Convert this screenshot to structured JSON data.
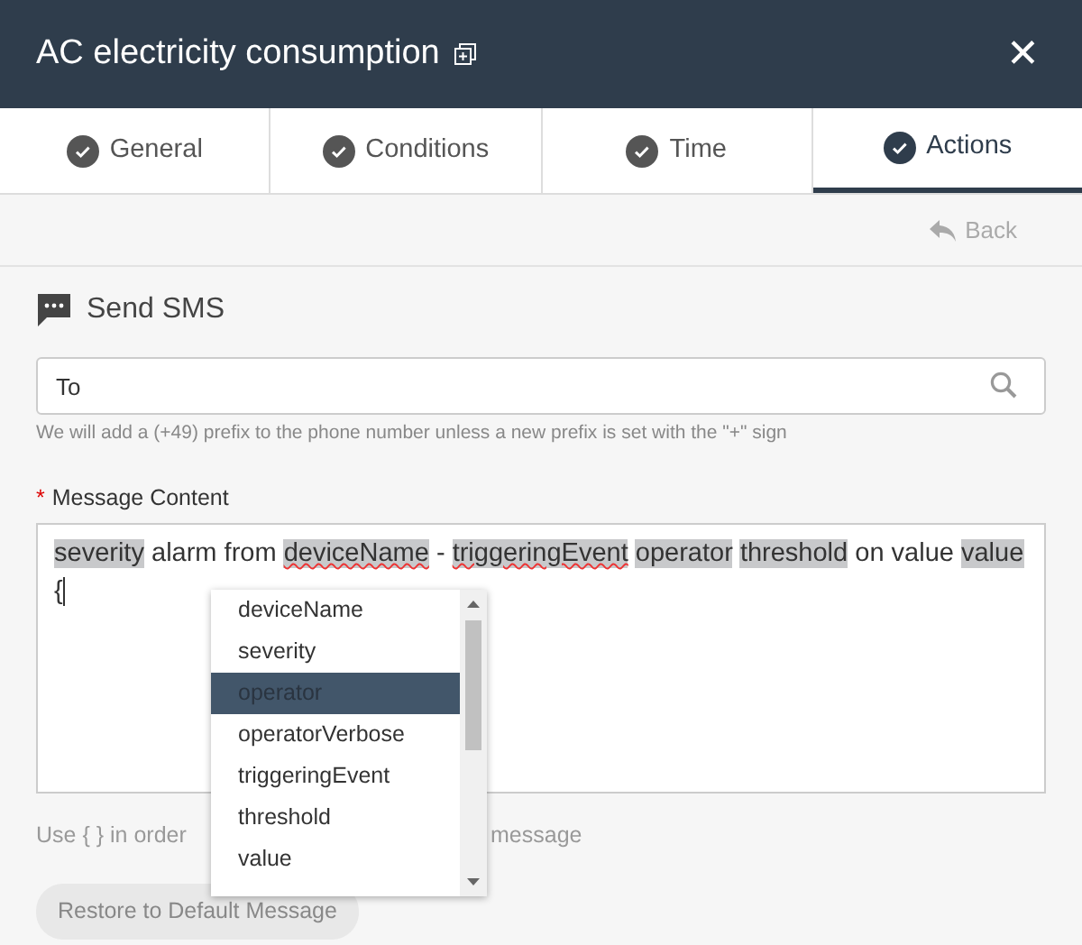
{
  "window": {
    "title": "AC electricity consumption",
    "close_label": "✕"
  },
  "tabs": [
    {
      "label": "General",
      "selected": false,
      "completed": true
    },
    {
      "label": "Conditions",
      "selected": false,
      "completed": true
    },
    {
      "label": "Time",
      "selected": false,
      "completed": true
    },
    {
      "label": "Actions",
      "selected": true,
      "completed": true
    }
  ],
  "toolbar": {
    "back": {
      "label": "Back",
      "disabled": true
    }
  },
  "section": {
    "title": "Send SMS"
  },
  "to_field": {
    "placeholder": "To"
  },
  "to_hint": "We will add a (+49) prefix to the phone number unless a new prefix is set with the \"+\" sign",
  "message": {
    "label": "Message Content",
    "required_mark": "*",
    "segments": [
      {
        "text": "severity",
        "kind": "token",
        "misspelled": false
      },
      {
        "text": "alarm from",
        "kind": "plain",
        "misspelled": false
      },
      {
        "text": "deviceName",
        "kind": "token",
        "misspelled": true
      },
      {
        "text": "-",
        "kind": "plain",
        "misspelled": false
      },
      {
        "text": "triggeringEvent",
        "kind": "token",
        "misspelled": true
      },
      {
        "text": "operator",
        "kind": "token",
        "misspelled": false
      },
      {
        "text": "threshold",
        "kind": "token",
        "misspelled": false
      },
      {
        "text": "on value",
        "kind": "plain",
        "misspelled": false
      },
      {
        "text": "value",
        "kind": "token",
        "misspelled": false
      },
      {
        "text": "{",
        "kind": "plain",
        "misspelled": false
      }
    ]
  },
  "message_hint": {
    "before": "Use { } in order",
    "after": "message"
  },
  "suggestions": [
    {
      "label": "deviceName",
      "selected": false
    },
    {
      "label": "severity",
      "selected": false
    },
    {
      "label": "operator",
      "selected": true
    },
    {
      "label": "operatorVerbose",
      "selected": false
    },
    {
      "label": "triggeringEvent",
      "selected": false
    },
    {
      "label": "threshold",
      "selected": false
    },
    {
      "label": "value",
      "selected": false
    }
  ],
  "restore_button": "Restore to Default Message"
}
